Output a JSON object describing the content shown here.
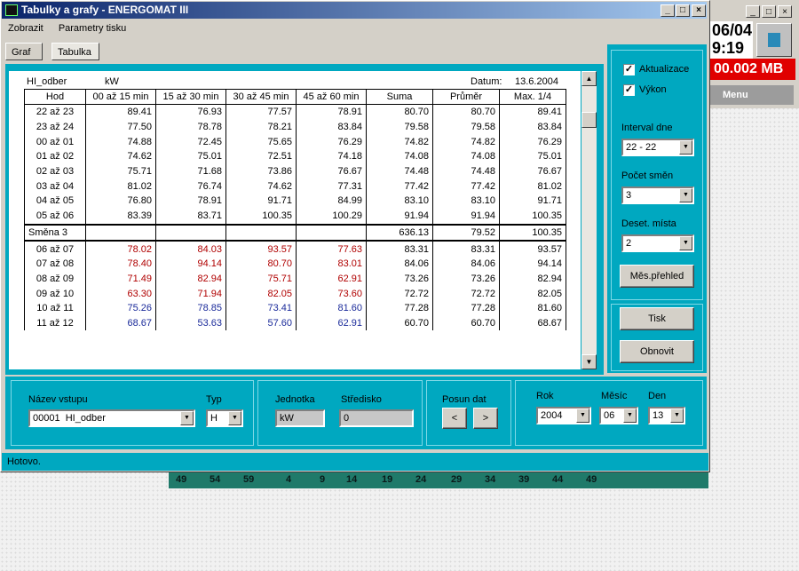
{
  "window": {
    "title": "Tabulky a grafy - ENERGOMAT III"
  },
  "menu": [
    "Zobrazit",
    "Parametry tisku"
  ],
  "tabs": [
    {
      "label": "Graf"
    },
    {
      "label": "Tabulka"
    }
  ],
  "table": {
    "input_name": "HI_odber",
    "unit": "kW",
    "date_label": "Datum:",
    "date": "13.6.2004",
    "headers": [
      "Hod",
      "00 až 15 min",
      "15 až 30 min",
      "30 až 45 min",
      "45 až 60 min",
      "Suma",
      "Průměr",
      "Max. 1/4"
    ],
    "rows": [
      {
        "hod": "22 až 23",
        "v": [
          "89.41",
          "76.93",
          "77.57",
          "78.91",
          "80.70",
          "80.70",
          "89.41"
        ],
        "color": "black"
      },
      {
        "hod": "23 až 24",
        "v": [
          "77.50",
          "78.78",
          "78.21",
          "83.84",
          "79.58",
          "79.58",
          "83.84"
        ],
        "color": "black"
      },
      {
        "hod": "00 až 01",
        "v": [
          "74.88",
          "72.45",
          "75.65",
          "76.29",
          "74.82",
          "74.82",
          "76.29"
        ],
        "color": "black"
      },
      {
        "hod": "01 až 02",
        "v": [
          "74.62",
          "75.01",
          "72.51",
          "74.18",
          "74.08",
          "74.08",
          "75.01"
        ],
        "color": "black"
      },
      {
        "hod": "02 až 03",
        "v": [
          "75.71",
          "71.68",
          "73.86",
          "76.67",
          "74.48",
          "74.48",
          "76.67"
        ],
        "color": "black"
      },
      {
        "hod": "03 až 04",
        "v": [
          "81.02",
          "76.74",
          "74.62",
          "77.31",
          "77.42",
          "77.42",
          "81.02"
        ],
        "color": "black"
      },
      {
        "hod": "04 až 05",
        "v": [
          "76.80",
          "78.91",
          "91.71",
          "84.99",
          "83.10",
          "83.10",
          "91.71"
        ],
        "color": "black"
      },
      {
        "hod": "05 až 06",
        "v": [
          "83.39",
          "83.71",
          "100.35",
          "100.29",
          "91.94",
          "91.94",
          "100.35"
        ],
        "color": "black"
      },
      {
        "hod": "Směna 3",
        "v": [
          "",
          "",
          "",
          "",
          "636.13",
          "79.52",
          "100.35"
        ],
        "color": "black",
        "subtotal": true
      },
      {
        "hod": "06 až 07",
        "v": [
          "78.02",
          "84.03",
          "93.57",
          "77.63",
          "83.31",
          "83.31",
          "93.57"
        ],
        "color": "red"
      },
      {
        "hod": "07 až 08",
        "v": [
          "78.40",
          "94.14",
          "80.70",
          "83.01",
          "84.06",
          "84.06",
          "94.14"
        ],
        "color": "red"
      },
      {
        "hod": "08 až 09",
        "v": [
          "71.49",
          "82.94",
          "75.71",
          "62.91",
          "73.26",
          "73.26",
          "82.94"
        ],
        "color": "red"
      },
      {
        "hod": "09 až 10",
        "v": [
          "63.30",
          "71.94",
          "82.05",
          "73.60",
          "72.72",
          "72.72",
          "82.05"
        ],
        "color": "red"
      },
      {
        "hod": "10 až 11",
        "v": [
          "75.26",
          "78.85",
          "73.41",
          "81.60",
          "77.28",
          "77.28",
          "81.60"
        ],
        "color": "blue"
      },
      {
        "hod": "11 až 12",
        "v": [
          "68.67",
          "53.63",
          "57.60",
          "62.91",
          "60.70",
          "60.70",
          "68.67"
        ],
        "color": "blue"
      }
    ]
  },
  "side": {
    "aktualizace": "Aktualizace",
    "vykon": "Výkon",
    "interval_label": "Interval dne",
    "interval_value": "22 - 22",
    "smen_label": "Počet směn",
    "smen_value": "3",
    "mista_label": "Deset. místa",
    "mista_value": "2",
    "mes_button": "Měs.přehled",
    "tisk_button": "Tisk",
    "obnovit_button": "Obnovit"
  },
  "bottom": {
    "nazev_label": "Název vstupu",
    "nazev_value": "00001  HI_odber",
    "typ_label": "Typ",
    "typ_value": "H",
    "jednotka_label": "Jednotka",
    "jednotka_value": "kW",
    "stredisko_label": "Středisko",
    "stredisko_value": "0",
    "posun_label": "Posun dat",
    "prev": "<",
    "next": ">",
    "rok_label": "Rok",
    "rok_value": "2004",
    "mesic_label": "Měsíc",
    "mesic_value": "06",
    "den_label": "Den",
    "den_value": "13"
  },
  "status": "Hotovo.",
  "background_window": {
    "date": "06/04",
    "time": "9:19",
    "mb": "00.002 MB",
    "menu": "Menu",
    "ticks": [
      "49",
      "54",
      "59",
      "4",
      "9",
      "14",
      "19",
      "24",
      "29",
      "34",
      "39",
      "44",
      "49"
    ]
  },
  "colors": {
    "teal": "#00a8c0",
    "title_start": "#0a246a",
    "red_values": "#b00000",
    "blue_values": "#1a2a9a"
  }
}
